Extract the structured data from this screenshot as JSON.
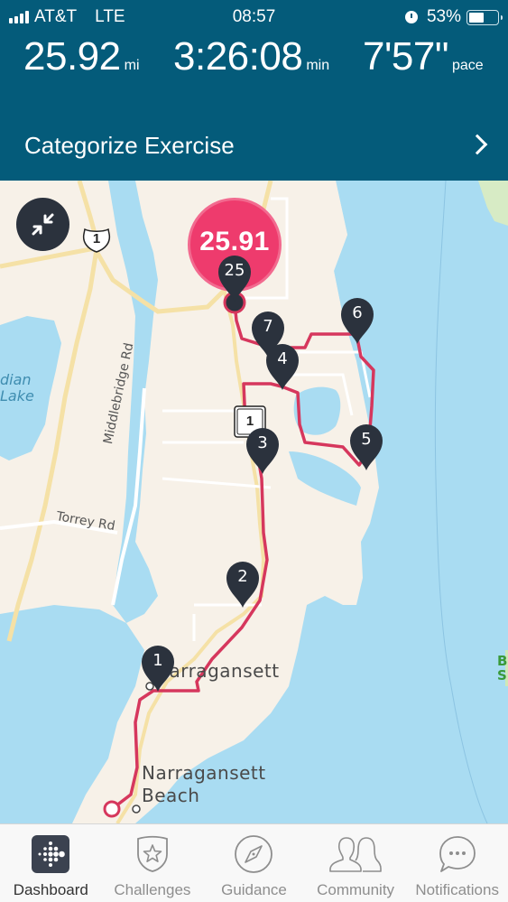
{
  "status_bar": {
    "carrier": "AT&T",
    "network": "LTE",
    "time": "08:57",
    "battery_percent_label": "53%",
    "battery_level": 0.53,
    "icons": [
      "signal-icon",
      "alarm-icon",
      "battery-icon"
    ]
  },
  "stats": {
    "distance": {
      "value": "25.92",
      "unit": "mi"
    },
    "duration": {
      "value": "3:26:08",
      "unit": "min"
    },
    "pace": {
      "value": "7'57\"",
      "unit": "pace"
    }
  },
  "categorize": {
    "label": "Categorize Exercise",
    "icon": "chevron-right-icon"
  },
  "map": {
    "collapse_icon": "collapse-arrows-icon",
    "total_distance_bubble": "25.91",
    "route_color": "#d6375d",
    "route_shield": "1",
    "route_shield_2": "1",
    "labels": {
      "lake": "dian\nLake",
      "middlebridge": "Middlebridge Rd",
      "torrey": "Torrey Rd",
      "narragansett": "Narragansett",
      "narragansett_beach_1": "Narragansett",
      "narragansett_beach_2": "Beach",
      "park": "B\nS"
    },
    "mile_markers": [
      "1",
      "2",
      "3",
      "4",
      "5",
      "6",
      "7",
      "25"
    ]
  },
  "tabbar": {
    "tabs": [
      {
        "label": "Dashboard",
        "icon": "fitbit-logo-icon",
        "active": true
      },
      {
        "label": "Challenges",
        "icon": "star-shield-icon",
        "active": false
      },
      {
        "label": "Guidance",
        "icon": "compass-icon",
        "active": false
      },
      {
        "label": "Community",
        "icon": "people-icon",
        "active": false
      },
      {
        "label": "Notifications",
        "icon": "chat-bubble-icon",
        "active": false
      }
    ]
  }
}
